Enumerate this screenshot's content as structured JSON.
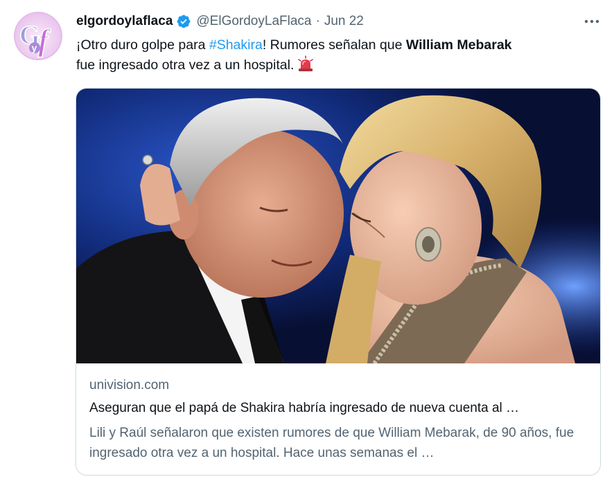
{
  "author": {
    "display_name": "elgordoylaflaca",
    "handle": "@ElGordoyLaFlaca",
    "separator": "·",
    "date": "Jun 22",
    "avatar_letters": "GyF"
  },
  "tweet": {
    "text_part1": "¡Otro duro golpe para ",
    "hashtag": "#Shakira",
    "text_part2": "! Rumores señalan que ",
    "bold_name": "William Mebarak",
    "text_part3": " fue ingresado otra vez a un hospital.",
    "emoji": "siren-icon"
  },
  "card": {
    "domain": "univision.com",
    "title": "Aseguran que el papá de Shakira habría ingresado de nueva cuenta al …",
    "description": "Lili y Raúl señalaron que existen rumores de que William Mebarak, de 90 años, fue ingresado otra vez a un hospital. Hace unas semanas el …"
  },
  "colors": {
    "link": "#1d9bf0",
    "secondary_text": "#536471",
    "verified": "#1d9bf0",
    "border": "#cfd9de"
  }
}
